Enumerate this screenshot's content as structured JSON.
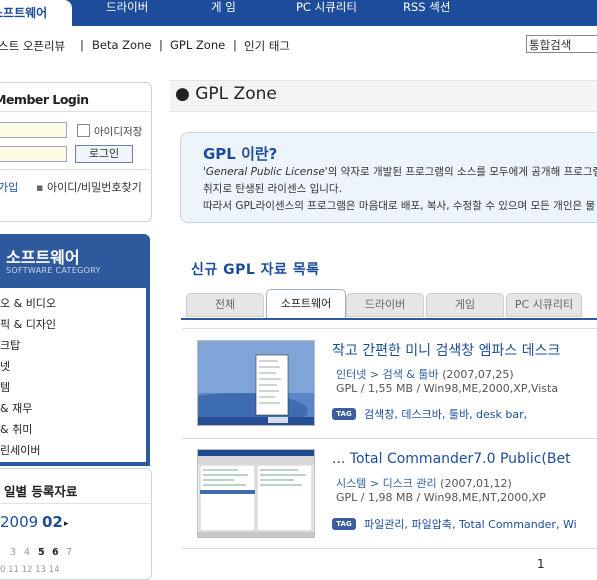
{
  "top_nav": {
    "active": "소프트웨어",
    "items": [
      "드라이버",
      "게  임",
      "PC 시큐리티",
      "RSS 섹션"
    ]
  },
  "sub_nav": {
    "items": [
      "스트 오픈리뷰",
      "Beta Zone",
      "GPL Zone",
      "인기 태그"
    ],
    "separator": "|",
    "search_select": "통합검색"
  },
  "login": {
    "title": "Member Login",
    "save_id_label": "아이디저장",
    "login_button": "로그인",
    "join_link": "가입",
    "find_link": "아이디/비밀번호찾기"
  },
  "category": {
    "title": "소프트웨어",
    "subtitle": "SOFTWARE CATEGORY",
    "items": [
      "오 & 비디오",
      "픽 & 디자인",
      "크탑",
      "넷",
      "템",
      "& 재무",
      "& 취미",
      "린세이버"
    ]
  },
  "calendar": {
    "title": "일별 등록자료",
    "year": "2009",
    "month": "02",
    "next": "▸",
    "row1": [
      "3",
      "4",
      "5",
      "6",
      "7"
    ],
    "row2": "0 11 12 13 14"
  },
  "main": {
    "zone_title": "GPL Zone",
    "gpl_question": "GPL 이란?",
    "gpl_line1_italic": "'General Public License'",
    "gpl_line1_rest": "의 약자로 개발된 프로그램의 소스를 모두에게 공개해 프로그램을",
    "gpl_line2": "취지로 탄생된 라이센스 입니다.",
    "gpl_line3": "따라서 GPL라이센스의 프로그램은 마음대로 배포, 복사, 수정할 수 있으며 모든 개인은 물",
    "list_title": "신규 GPL 자료 목록",
    "tabs": [
      "전체",
      "소프트웨어",
      "드라이버",
      "게임",
      "PC 시큐리티"
    ],
    "active_tab": 1
  },
  "items": [
    {
      "title": "작고 간편한 미니 검색창  엠파스 데스크",
      "category": "인터넷 > 검색 & 툴바",
      "date": "(2007,07,25)",
      "info": "GPL / 1,55 MB / Win98,ME,2000,XP,Vista",
      "tag_badge": "TAG",
      "tags": "검색창, 데스크바, 툴바, desk bar,"
    },
    {
      "title": "...  Total Commander7.0 Public(Bet",
      "category": "시스템 > 디스크 관리",
      "date": "(2007,01,12)",
      "info": "GPL / 1,98 MB / Win98,ME,NT,2000,XP",
      "tag_badge": "TAG",
      "tags": "파일관리, 파일압축, Total Commander, Wi"
    }
  ],
  "pagination": {
    "current": "1"
  },
  "colors": {
    "brand": "#1d4d9a",
    "category_bg": "#2d5a9d"
  }
}
